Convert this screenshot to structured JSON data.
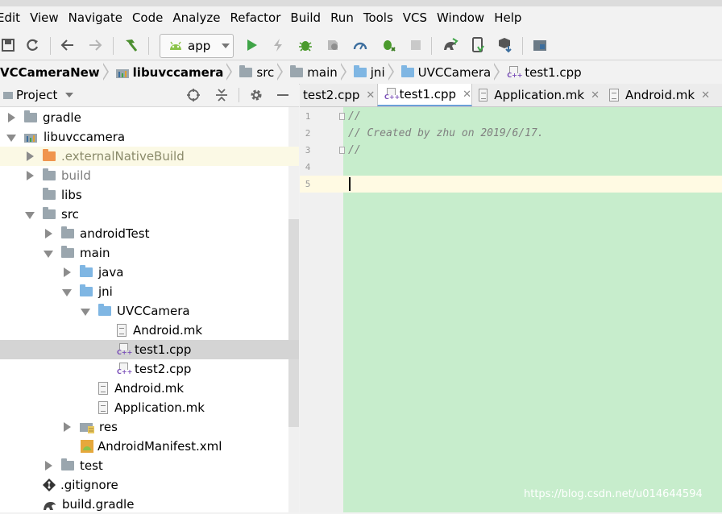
{
  "menu": [
    "Edit",
    "View",
    "Navigate",
    "Code",
    "Analyze",
    "Refactor",
    "Build",
    "Run",
    "Tools",
    "VCS",
    "Window",
    "Help"
  ],
  "toolbar": {
    "config_label": "app",
    "colors": {
      "run": "#3fa447",
      "debug": "#4a9a2c",
      "hammer": "#4c8f30",
      "android": "#8bc34a"
    }
  },
  "breadcrumb": [
    "VCCameraNew",
    "libuvccamera",
    "src",
    "main",
    "jni",
    "UVCCamera",
    "test1.cpp"
  ],
  "project": {
    "title": "Project",
    "tree": [
      {
        "label": "gradle",
        "indent": 0,
        "arrow": "right",
        "icon": "folder"
      },
      {
        "label": "libuvccamera",
        "indent": 0,
        "arrow": "down",
        "icon": "module-folder"
      },
      {
        "label": ".externalNativeBuild",
        "indent": 1,
        "arrow": "right",
        "icon": "folder-orange",
        "state": "hl"
      },
      {
        "label": "build",
        "indent": 1,
        "arrow": "right",
        "icon": "folder",
        "state": "gray"
      },
      {
        "label": "libs",
        "indent": 1,
        "arrow": "none",
        "icon": "folder"
      },
      {
        "label": "src",
        "indent": 1,
        "arrow": "down",
        "icon": "folder"
      },
      {
        "label": "androidTest",
        "indent": 2,
        "arrow": "right",
        "icon": "folder"
      },
      {
        "label": "main",
        "indent": 2,
        "arrow": "down",
        "icon": "folder"
      },
      {
        "label": "java",
        "indent": 3,
        "arrow": "right",
        "icon": "folder-blue"
      },
      {
        "label": "jni",
        "indent": 3,
        "arrow": "down",
        "icon": "folder-blue"
      },
      {
        "label": "UVCCamera",
        "indent": 4,
        "arrow": "down",
        "icon": "folder-blue"
      },
      {
        "label": "Android.mk",
        "indent": 5,
        "arrow": "none",
        "icon": "file"
      },
      {
        "label": "test1.cpp",
        "indent": 5,
        "arrow": "none",
        "icon": "cpp",
        "state": "sel"
      },
      {
        "label": "test2.cpp",
        "indent": 5,
        "arrow": "none",
        "icon": "cpp"
      },
      {
        "label": "Android.mk",
        "indent": 4,
        "arrow": "none",
        "icon": "file"
      },
      {
        "label": "Application.mk",
        "indent": 4,
        "arrow": "none",
        "icon": "file"
      },
      {
        "label": "res",
        "indent": 3,
        "arrow": "right",
        "icon": "res-folder"
      },
      {
        "label": "AndroidManifest.xml",
        "indent": 3,
        "arrow": "none",
        "icon": "manifest"
      },
      {
        "label": "test",
        "indent": 2,
        "arrow": "right",
        "icon": "folder"
      },
      {
        "label": ".gitignore",
        "indent": 1,
        "arrow": "none",
        "icon": "git"
      },
      {
        "label": "build.gradle",
        "indent": 1,
        "arrow": "none",
        "icon": "gradle"
      }
    ]
  },
  "tabs": [
    {
      "label": "test2.cpp",
      "icon": "cpp"
    },
    {
      "label": "test1.cpp",
      "icon": "cpp",
      "active": true
    },
    {
      "label": "Application.mk",
      "icon": "file"
    },
    {
      "label": "Android.mk",
      "icon": "file"
    }
  ],
  "editor": {
    "line_numbers": [
      "1",
      "2",
      "3",
      "4",
      "5"
    ],
    "lines": [
      "//",
      "// Created by zhu on 2019/6/17.",
      "//",
      "",
      ""
    ]
  },
  "watermark": "https://blog.csdn.net/u014644594"
}
